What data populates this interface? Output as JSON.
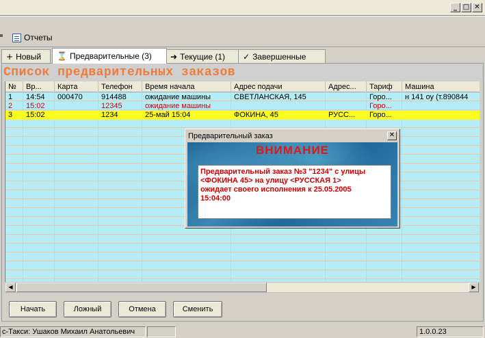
{
  "window": {
    "buttons": [
      "_",
      "□",
      "✕"
    ]
  },
  "menu": {
    "reports_label": "Отчеты"
  },
  "tabs": [
    {
      "label": "Новый",
      "icon": "+"
    },
    {
      "label": "Предварительные (3)",
      "icon": "⌛"
    },
    {
      "label": "Текущие (1)",
      "icon": "➜"
    },
    {
      "label": "Завершенные",
      "icon": "✓"
    }
  ],
  "list_title": "Список предварительных заказов",
  "grid": {
    "columns": [
      "№",
      "Вр...",
      "Карта",
      "Телефон",
      "Время начала",
      "Адрес подачи",
      "Адрес...",
      "Тариф",
      "Машина"
    ],
    "rows": [
      [
        "1",
        "14:54",
        "000470",
        "914488",
        "ожидание машины",
        "СВЕТЛАНСКАЯ, 145",
        "",
        "Горо...",
        "н 141 оу (т.890844"
      ],
      [
        "2",
        "15:02",
        "",
        "12345",
        "ожидание машины",
        "",
        "",
        "Горо...",
        ""
      ],
      [
        "3",
        "15:02",
        "",
        "1234",
        "25-май 15:04",
        "ФОКИНА, 45",
        "РУСС...",
        "Горо...",
        ""
      ]
    ]
  },
  "buttons": {
    "start": "Начать",
    "false": "Ложный",
    "cancel": "Отмена",
    "change": "Сменить"
  },
  "status": {
    "user": "с-Такси: Ушаков Михаил Анатольевич",
    "version": "1.0.0.23"
  },
  "dialog": {
    "title": "Предварительный заказ",
    "close": "✕",
    "warning": "ВНИМАНИЕ",
    "message_lines": [
      "Предварительный заказ №3 \"1234\" с улицы",
      "<ФОКИНА 45> на улицу <РУССКАЯ 1>",
      "ожидает своего исполнения к 25.05.2005",
      "15:04:00"
    ]
  },
  "colors": {
    "grid_bg": "#b5ecf8",
    "selected_row": "#ffff22",
    "title_orange": "#f07c3c",
    "alert_red": "#d00000"
  }
}
